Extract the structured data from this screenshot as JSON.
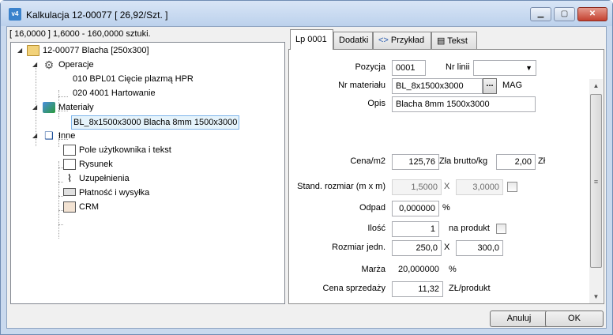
{
  "window": {
    "title": "Kalkulacja 12-00077 [ 26,92/Szt. ]",
    "app_icon": "calc-app-icon",
    "minimize_glyph": "▁",
    "maximize_glyph": "▢",
    "close_glyph": "✕"
  },
  "range_label": "[ 16,0000 ]  1,6000 - 160,0000 sztuki.",
  "tree": {
    "root": "12-00077 Blacha [250x300]",
    "operacje": "Operacje",
    "op1": "010 BPL01 Cięcie plazmą HPR",
    "op2": "020 4001 Hartowanie",
    "materialy": "Materiały",
    "mat1": "BL_8x1500x3000 Blacha 8mm 1500x3000",
    "inne": "Inne",
    "inne_items": [
      "Pole użytkownika i tekst",
      "Rysunek",
      "Uzupełnienia",
      "Płatność i wysyłka",
      "CRM"
    ]
  },
  "tabs": {
    "lp": "Lp 0001",
    "dodatki": "Dodatki",
    "przyklad": "Przykład",
    "tekst": "Tekst"
  },
  "form": {
    "pozycja_label": "Pozycja",
    "pozycja_value": "0001",
    "nr_linii_label": "Nr linii",
    "nr_materialu_label": "Nr materiału",
    "nr_materialu_value": "BL_8x1500x3000",
    "mag_label": "MAG",
    "opis_label": "Opis",
    "opis_value": "Blacha 8mm 1500x3000",
    "cena_m2_label": "Cena/m2",
    "cena_m2_value": "125,76",
    "cena_m2_unit": "Zła brutto/kg",
    "cena_kg_value": "2,00",
    "cena_kg_unit": "Zł",
    "stand_label": "Stand. rozmiar (m x m)",
    "stand_w": "1,5000",
    "stand_x": "X",
    "stand_h": "3,0000",
    "odpad_label": "Odpad",
    "odpad_value": "0,000000",
    "odpad_unit": "%",
    "ilosc_label": "Ilość",
    "ilosc_value": "1",
    "na_produkt_label": "na produkt",
    "rozmiar_label": "Rozmiar jedn.",
    "rozmiar_w": "250,0",
    "rozmiar_x": "X",
    "rozmiar_h": "300,0",
    "marza_label": "Marża",
    "marza_value": "20,000000",
    "marza_unit": "%",
    "cena_sprzedazy_label": "Cena sprzedaży",
    "cena_sprzedazy_value": "11,32",
    "cena_sprzedazy_unit": "ZŁ/produkt"
  },
  "buttons": {
    "anuluj": "Anuluj",
    "ok": "OK"
  }
}
